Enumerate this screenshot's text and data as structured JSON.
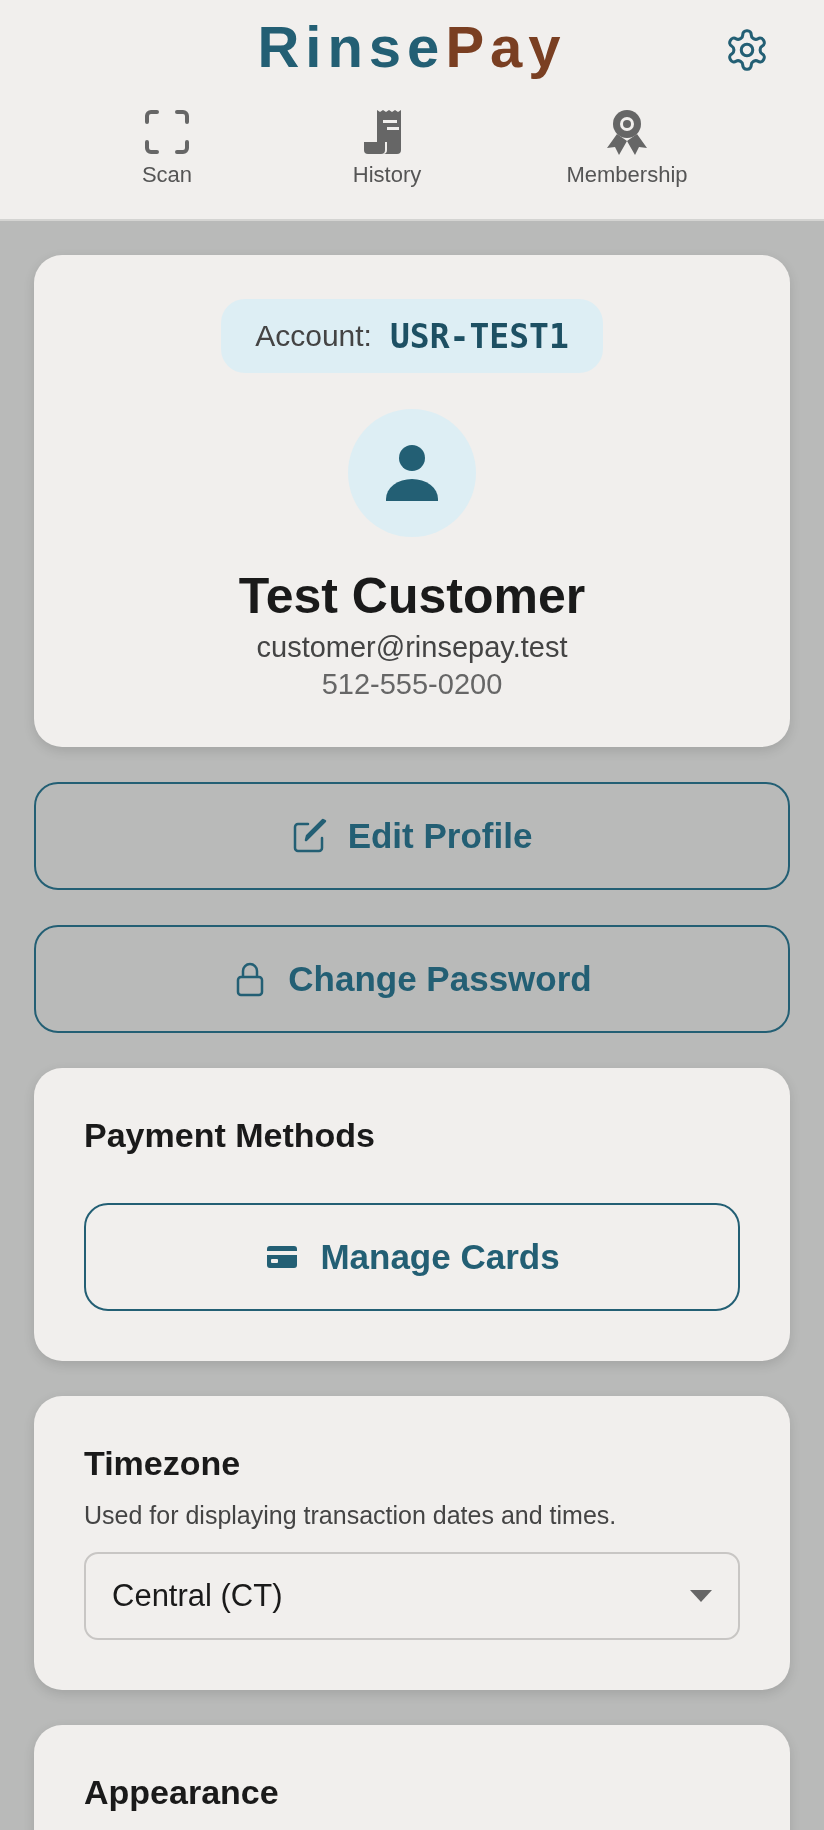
{
  "header": {
    "logo": [
      "Rinse",
      "Pay"
    ],
    "nav": [
      {
        "kind": "scan",
        "label": "Scan"
      },
      {
        "kind": "history",
        "label": "History"
      },
      {
        "kind": "membership",
        "label": "Membership"
      }
    ]
  },
  "profile": {
    "account_label": "Account:",
    "account_id": "USR-TEST1",
    "name": "Test Customer",
    "email": "customer@rinsepay.test",
    "phone": "512-555-0200"
  },
  "actions": [
    {
      "kind": "edit",
      "label": "Edit Profile"
    },
    {
      "kind": "lock",
      "label": "Change Password"
    }
  ],
  "payment": {
    "title": "Payment Methods",
    "button": "Manage Cards"
  },
  "timezone": {
    "title": "Timezone",
    "description": "Used for displaying transaction dates and times.",
    "value": "Central (CT)"
  },
  "appearance": {
    "title": "Appearance"
  }
}
